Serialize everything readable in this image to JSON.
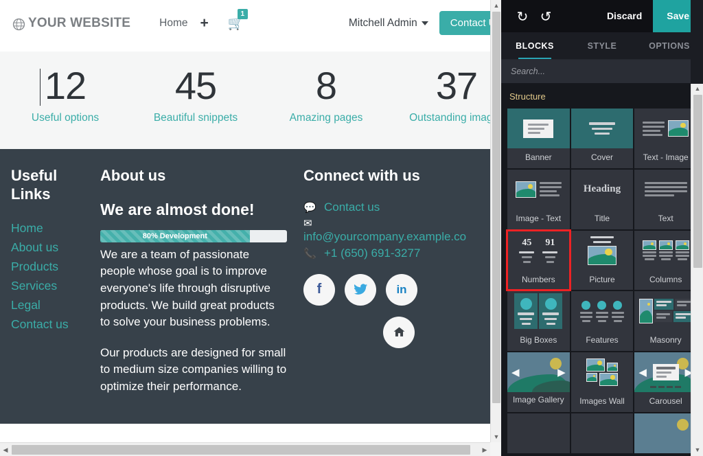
{
  "website": {
    "header": {
      "brand": "YOUR WEBSITE",
      "brand_icon": "globe-icon",
      "nav": [
        {
          "label": "Home",
          "icon": ""
        },
        {
          "label": "",
          "icon": "plus-icon"
        }
      ],
      "cart_icon": "shopping-cart-icon",
      "cart_badge": "1",
      "user_menu": "Mitchell Admin",
      "user_caret_icon": "chevron-down-icon",
      "contact_button": "Contact Us"
    },
    "numbers": [
      {
        "value": "12",
        "label": "Useful options"
      },
      {
        "value": "45",
        "label": "Beautiful snippets"
      },
      {
        "value": "8",
        "label": "Amazing pages"
      },
      {
        "value": "37",
        "label": "Outstanding images"
      }
    ],
    "footer": {
      "links_title": "Useful Links",
      "links": [
        "Home",
        "About us",
        "Products",
        "Services",
        "Legal",
        "Contact us"
      ],
      "about_title": "About us",
      "about_heading": "We are almost done!",
      "progress_label": "80% Development",
      "progress_percent": 80,
      "about_paragraph_1": "We are a team of passionate people whose goal is to improve everyone's life through disruptive products. We build great products to solve your business problems.",
      "about_paragraph_2": "Our products are designed for small to medium size companies willing to optimize their performance.",
      "connect_title": "Connect with us",
      "contact_link": "Contact us",
      "contact_icon": "comment-icon",
      "email": "info@yourcompany.example.co",
      "email_icon": "envelope-icon",
      "phone": "+1 (650) 691-3277",
      "phone_icon": "phone-icon",
      "social": [
        {
          "name": "facebook-icon",
          "glyph": "f"
        },
        {
          "name": "twitter-icon",
          "glyph": "ᴠ"
        },
        {
          "name": "linkedin-icon",
          "glyph": "in"
        }
      ],
      "scroll_top_icon": "home-icon"
    }
  },
  "editor": {
    "toolbar": {
      "undo_icon": "undo-icon",
      "redo_icon": "redo-icon",
      "discard_label": "Discard",
      "save_label": "Save"
    },
    "tabs": [
      {
        "label": "BLOCKS",
        "active": true
      },
      {
        "label": "STYLE",
        "active": false
      },
      {
        "label": "OPTIONS",
        "active": false
      }
    ],
    "search": {
      "placeholder": "Search...",
      "value": ""
    },
    "sections": [
      {
        "title": "Structure",
        "blocks": [
          {
            "label": "Banner",
            "highlight": false
          },
          {
            "label": "Cover",
            "highlight": false
          },
          {
            "label": "Text - Image",
            "highlight": false
          },
          {
            "label": "Image - Text",
            "highlight": false
          },
          {
            "label": "Title",
            "highlight": false
          },
          {
            "label": "Text",
            "highlight": false
          },
          {
            "label": "Numbers",
            "highlight": true
          },
          {
            "label": "Picture",
            "highlight": false
          },
          {
            "label": "Columns",
            "highlight": false
          },
          {
            "label": "Big Boxes",
            "highlight": false
          },
          {
            "label": "Features",
            "highlight": false
          },
          {
            "label": "Masonry",
            "highlight": false
          },
          {
            "label": "Image Gallery",
            "highlight": false
          },
          {
            "label": "Images Wall",
            "highlight": false
          },
          {
            "label": "Carousel",
            "highlight": false
          }
        ]
      }
    ],
    "thumb_numbers": [
      "45",
      "91"
    ],
    "thumb_heading": "Heading"
  },
  "colors": {
    "accent_teal": "#3aada8",
    "footer_dark": "#37414a",
    "editor_dark": "#1b1d23",
    "highlight_red": "#ee2224",
    "save_teal": "#1fa3a0"
  }
}
